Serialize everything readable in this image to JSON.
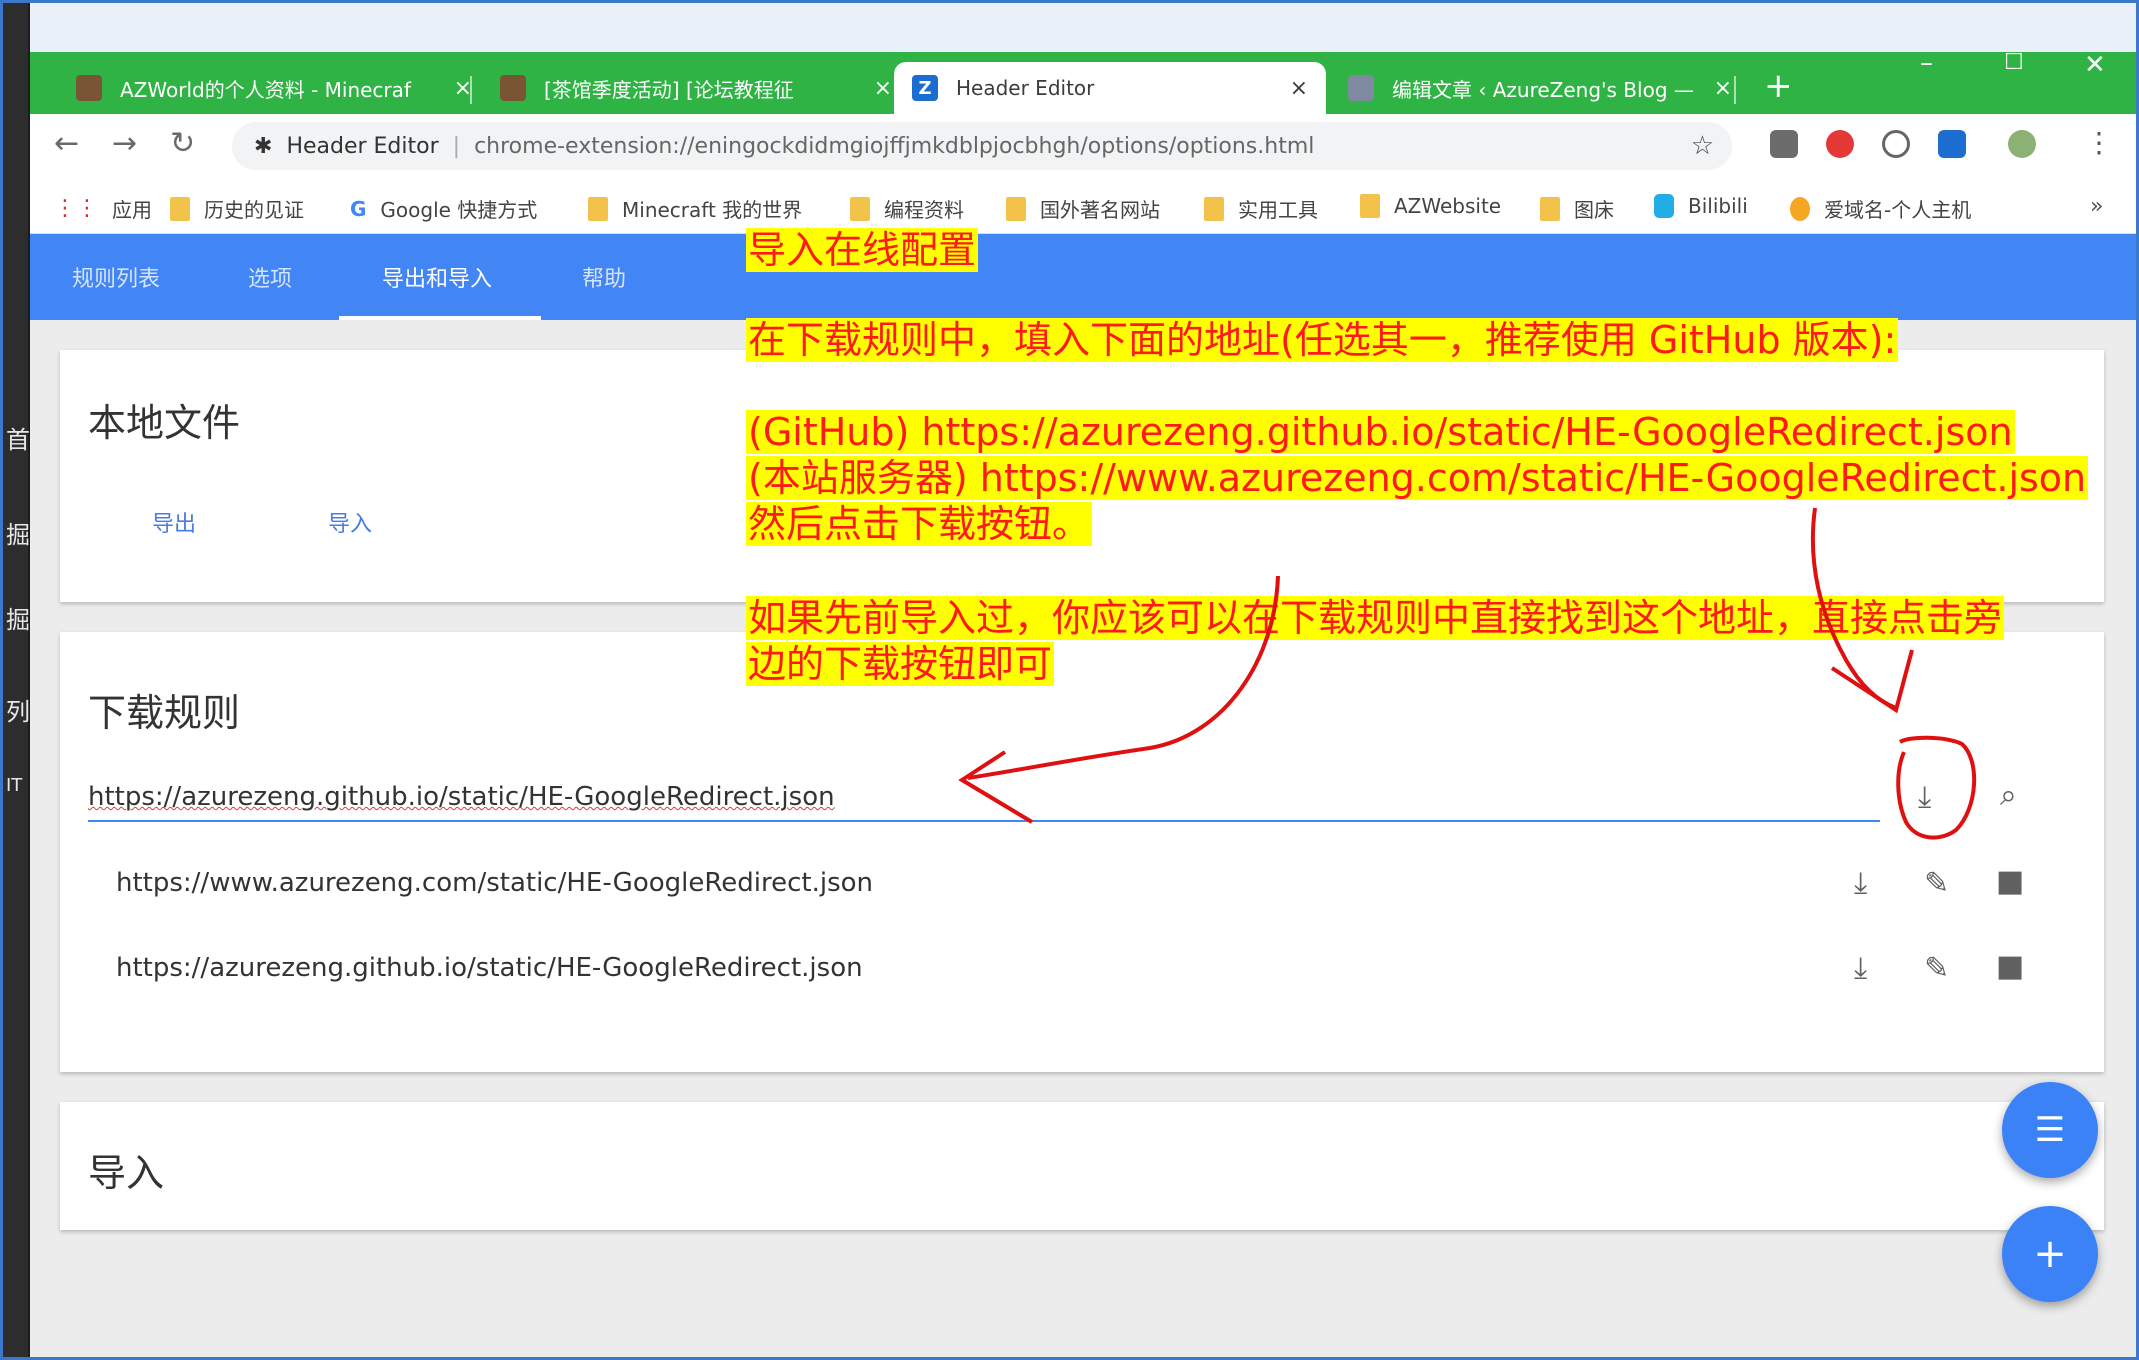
{
  "desktop": {
    "chars": [
      "首",
      "掘",
      "掘",
      "列",
      "IT"
    ]
  },
  "browser": {
    "tabs": [
      {
        "title": "AZWorld的个人资料 - Minecraf",
        "icon": "minecraft-icon",
        "active": false
      },
      {
        "title": "[茶馆季度活动] [论坛教程征",
        "icon": "minecraft-icon",
        "active": false
      },
      {
        "title": "Header Editor",
        "icon": "header-editor-icon",
        "active": true
      },
      {
        "title": "编辑文章 ‹ AzureZeng's Blog —",
        "icon": "blog-icon",
        "active": false
      }
    ],
    "tab_close": "×",
    "new_tab": "+",
    "window_controls": {
      "minimize": "–",
      "maximize": "☐",
      "close": "✕"
    },
    "omnibox": {
      "site_name": "Header Editor",
      "url": "chrome-extension://eningockdidmgiojffjmkdblpjocbhgh/options/options.html"
    },
    "bookmarks": [
      {
        "label": "应用",
        "icon": "apps-icon"
      },
      {
        "label": "历史的见证",
        "icon": "folder-icon"
      },
      {
        "label": "Google 快捷方式",
        "icon": "google-icon"
      },
      {
        "label": "Minecraft 我的世界",
        "icon": "folder-icon"
      },
      {
        "label": "编程资料",
        "icon": "folder-icon"
      },
      {
        "label": "国外著名网站",
        "icon": "folder-icon"
      },
      {
        "label": "实用工具",
        "icon": "folder-icon"
      },
      {
        "label": "AZWebsite",
        "icon": "folder-icon"
      },
      {
        "label": "图床",
        "icon": "folder-icon"
      },
      {
        "label": "Bilibili",
        "icon": "bilibili-icon"
      },
      {
        "label": "爱域名-个人主机",
        "icon": "sun-icon"
      }
    ],
    "bookmarks_more": "»"
  },
  "app": {
    "nav": [
      {
        "label": "规则列表",
        "active": false
      },
      {
        "label": "选项",
        "active": false
      },
      {
        "label": "导出和导入",
        "active": true
      },
      {
        "label": "帮助",
        "active": false
      }
    ],
    "local_file": {
      "title": "本地文件",
      "export_label": "导出",
      "import_label": "导入"
    },
    "download_rules": {
      "title": "下载规则",
      "input_value": "https://azurezeng.github.io/static/HE-GoogleRedirect.json",
      "items": [
        "https://www.azurezeng.com/static/HE-GoogleRedirect.json",
        "https://azurezeng.github.io/static/HE-GoogleRedirect.json"
      ]
    },
    "import_section": {
      "title": "导入"
    }
  },
  "annotations": {
    "line1": "导入在线配置",
    "line2": "在下载规则中，填入下面的地址(任选其一，推荐使用 GitHub 版本):",
    "line3": "(GitHub) https://azurezeng.github.io/static/HE-GoogleRedirect.json",
    "line4": "(本站服务器) https://www.azurezeng.com/static/HE-GoogleRedirect.json",
    "line5": "然后点击下载按钮。",
    "line6": "如果先前导入过，你应该可以在下载规则中直接找到这个地址，直接点击旁",
    "line7": "边的下载按钮即可",
    "color": "#ff1a1a",
    "highlight": "#ffff00"
  },
  "theme": {
    "tabstrip": "#2fb344",
    "primary": "#4285f4",
    "fab": "#3b82f6"
  }
}
